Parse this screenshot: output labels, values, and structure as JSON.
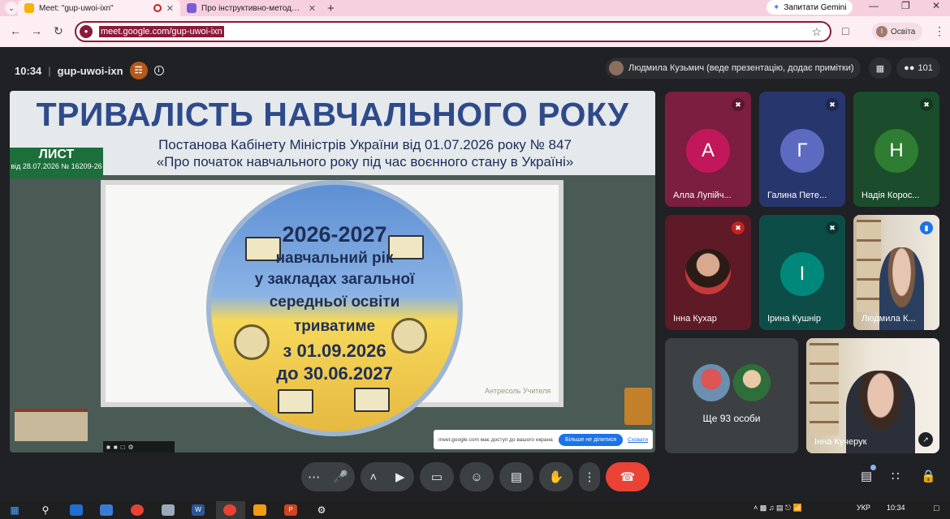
{
  "browser": {
    "tabs": [
      {
        "label": "Meet: \"gup-uwoi-ixn\"",
        "icon": "meet-icon",
        "color": "#f4b400",
        "active": true
      },
      {
        "label": "Про інструктивно-методичні р",
        "icon": "docs-icon",
        "color": "#7b5cd6",
        "active": false
      }
    ],
    "gemini_label": "Запитати Gemini",
    "url": "meet.google.com/gup-uwoi-ixn",
    "profile_initial": "І",
    "profile_label": "Освіта"
  },
  "meet": {
    "time": "10:34",
    "meeting_code": "gup-uwoi-ixn",
    "host_badge": "☶",
    "presenter_label": "Людмила Кузьмич (веде презентацію, додає примітки)",
    "participant_count": "101"
  },
  "slide": {
    "title": "ТРИВАЛІСТЬ НАВЧАЛЬНОГО РОКУ",
    "subtitle1": "Постанова Кабінету Міністрів України від 01.07.2026 року № 847",
    "subtitle2": "«Про початок навчального року під час воєнного стану в Україні»",
    "badge_title": "ЛИСТ",
    "badge_sub": "від 28.07.2026 № 16209-26",
    "lines": [
      "2026-2027",
      "навчальний рік",
      "у закладах загальної",
      "середньої освіти",
      "триватиме",
      "з 01.09.2026",
      "до 30.06.2027"
    ],
    "watermark": "Антресоль Учителя",
    "share_note": "meet.google.com має доступ до вашого екрана",
    "stop_sharing": "Більше не ділитися",
    "hide": "Сховати"
  },
  "participants": [
    {
      "name": "Алла Лупійч...",
      "initial": "А",
      "bg": "#7b1e3f",
      "circle": "#c2185b",
      "muted": true
    },
    {
      "name": "Галина Пете...",
      "initial": "Г",
      "bg": "#28366e",
      "circle": "#5c6bc0",
      "muted": true
    },
    {
      "name": "Надія Корос...",
      "initial": "Н",
      "bg": "#1b4d2c",
      "circle": "#2e7d32",
      "muted": true
    },
    {
      "name": "Інна Кухар",
      "initial": "",
      "bg": "#5e1a26",
      "circle": "",
      "muted": true
    },
    {
      "name": "Ірина Кушнір",
      "initial": "І",
      "bg": "#0d4d48",
      "circle": "#00897b",
      "muted": true
    },
    {
      "name": "Людмила К...",
      "initial": "",
      "bg": "#d9cfc2",
      "circle": "",
      "muted": false
    },
    {
      "name": "Ще 93 особи",
      "initial": "",
      "bg": "#3c4043",
      "circle": "",
      "muted": false
    },
    {
      "name": "Інна Кучерук",
      "initial": "",
      "bg": "#e8e0d4",
      "circle": "",
      "muted": false
    }
  ],
  "taskbar": {
    "lang": "УКР",
    "clock_time": "10:34"
  }
}
